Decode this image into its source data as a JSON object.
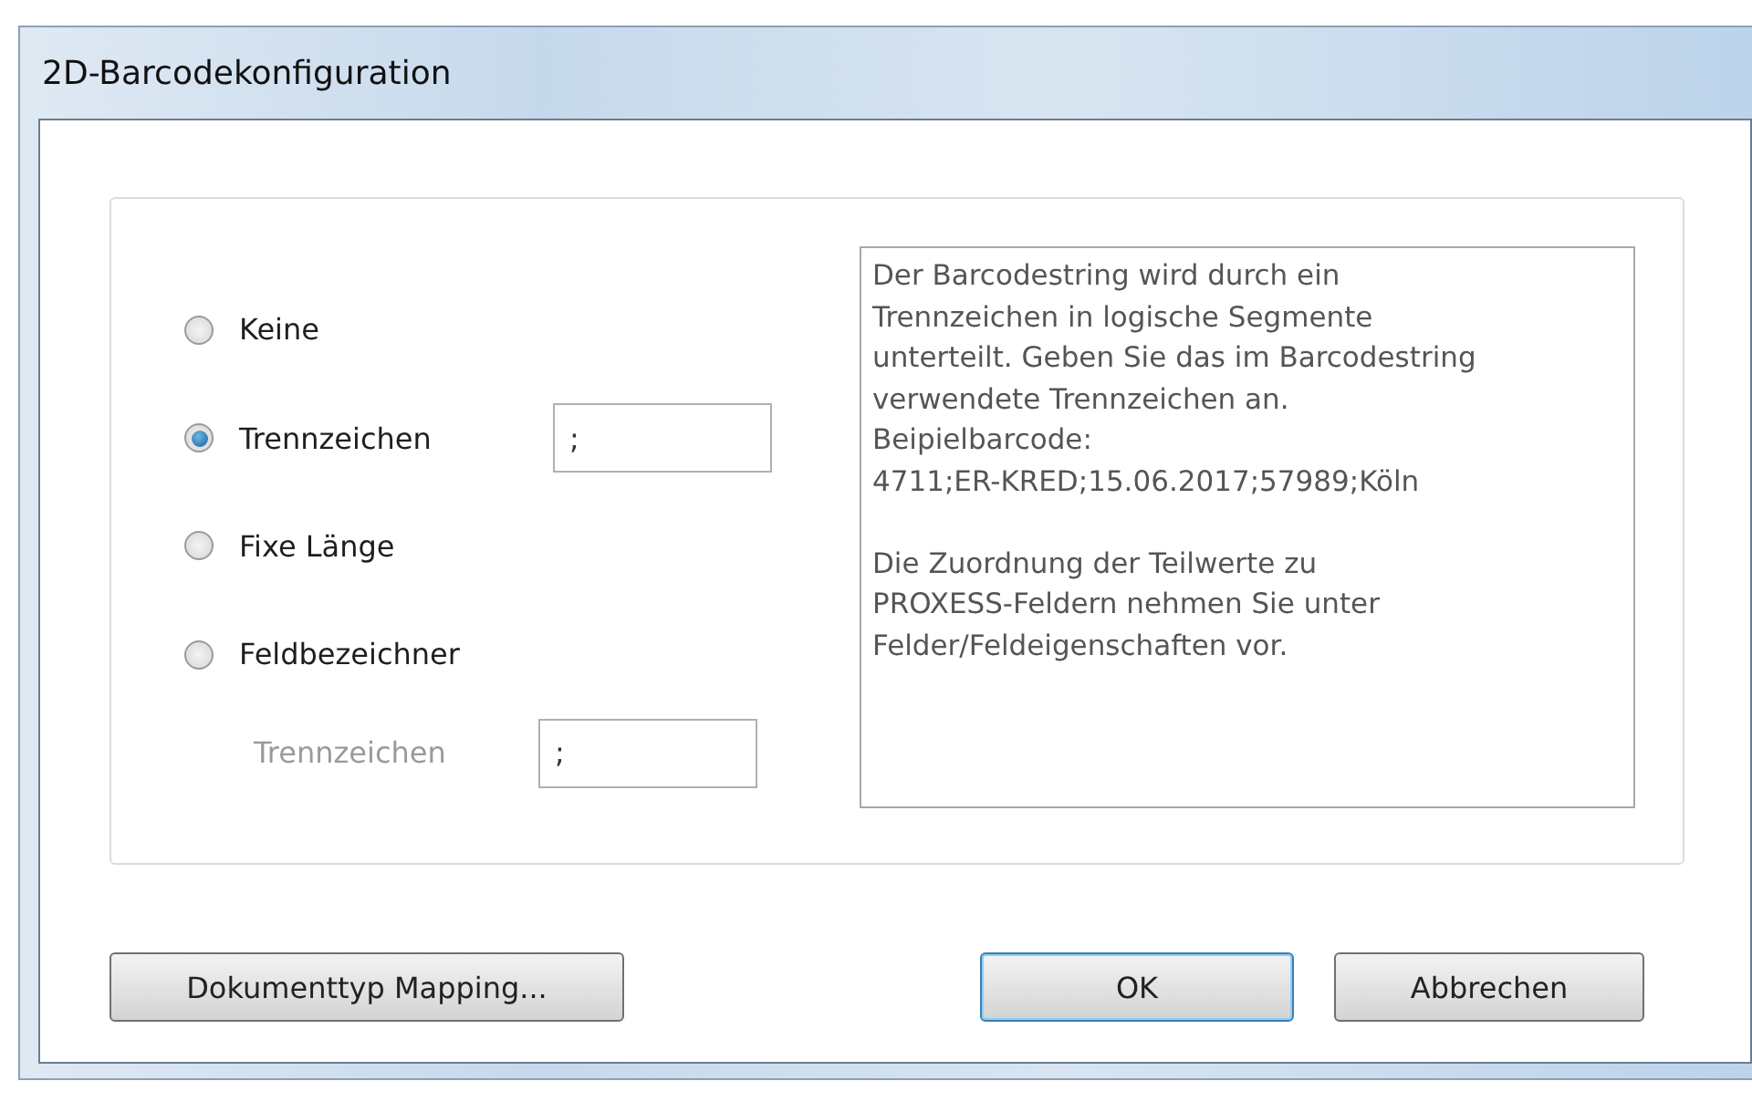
{
  "window": {
    "title": "2D-Barcodekonfiguration"
  },
  "options": [
    {
      "label": "Keine",
      "selected": false
    },
    {
      "label": "Trennzeichen",
      "selected": true,
      "value": ";"
    },
    {
      "label": "Fixe Länge",
      "selected": false
    },
    {
      "label": "Feldbezeichner",
      "selected": false,
      "sub": {
        "label": "Trennzeichen",
        "value": ";",
        "disabled": true
      }
    }
  ],
  "description": [
    "Der Barcodestring wird durch ein\nTrennzeichen in logische Segmente\nunterteilt. Geben Sie das im Barcodestring\nverwendete Trennzeichen an.\nBeipielbarcode:\n4711;ER-KRED;15.06.2017;57989;Köln",
    "Die Zuordnung der Teilwerte zu\nPROXESS-Feldern nehmen Sie unter\nFelder/Feldeigenschaften vor."
  ],
  "buttons": [
    {
      "label": "Dokumenttyp Mapping...",
      "default": false
    },
    {
      "label": "OK",
      "default": true
    },
    {
      "label": "Abbrechen",
      "default": false
    }
  ]
}
